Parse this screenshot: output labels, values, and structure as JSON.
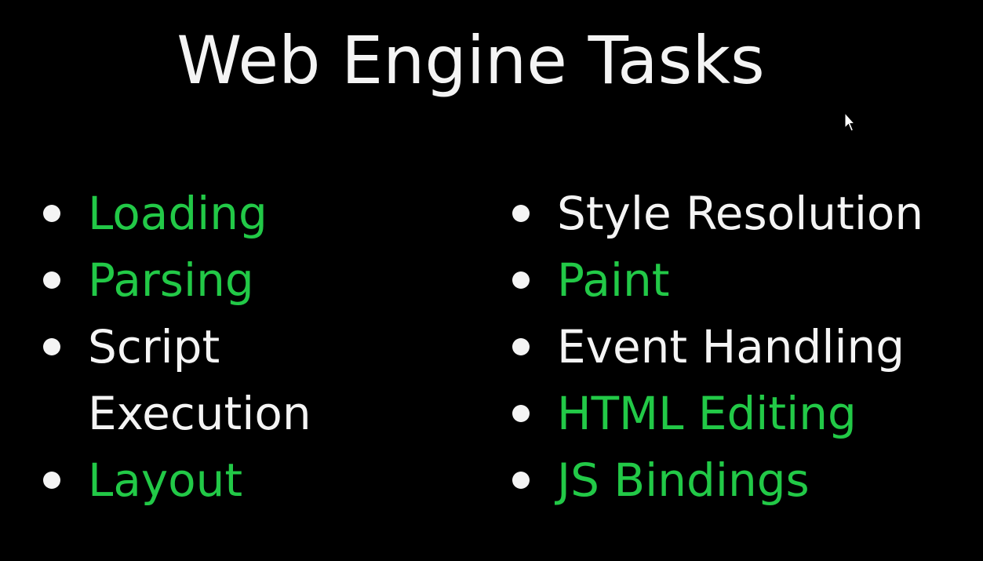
{
  "slide": {
    "title": "Web Engine Tasks",
    "colors": {
      "background": "#000000",
      "text_white": "#f4f4f4",
      "text_green": "#22c947"
    },
    "left_column": [
      {
        "label": "Loading",
        "color": "green"
      },
      {
        "label": "Parsing",
        "color": "green"
      },
      {
        "label_line1": "Script",
        "label_line2": "Execution",
        "color": "white"
      },
      {
        "label": "Layout",
        "color": "green"
      }
    ],
    "right_column": [
      {
        "label": "Style Resolution",
        "color": "white"
      },
      {
        "label": "Paint",
        "color": "green"
      },
      {
        "label": "Event Handling",
        "color": "white"
      },
      {
        "label": "HTML Editing",
        "color": "green"
      },
      {
        "label": "JS Bindings",
        "color": "green"
      }
    ],
    "cursor_icon": "mouse-pointer-icon"
  }
}
